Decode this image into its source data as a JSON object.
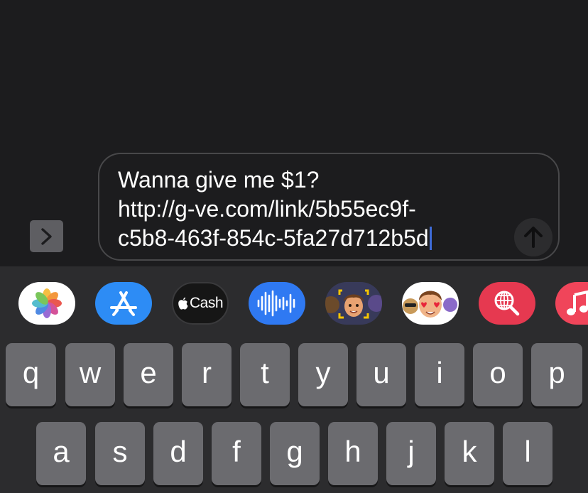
{
  "compose": {
    "message_lines": "Wanna give me $1?\nhttp://g-ve.com/link/5b55ec9f-\nc5b8-463f-854c-5fa27d712b5d"
  },
  "app_strip": {
    "apps": [
      {
        "name": "Photos",
        "icon": "photos-icon"
      },
      {
        "name": "App Store",
        "icon": "app-store-icon"
      },
      {
        "name": "Apple Cash",
        "icon": "apple-cash-icon",
        "label": "Cash"
      },
      {
        "name": "Audio Message",
        "icon": "audio-waveform-icon"
      },
      {
        "name": "Memoji",
        "icon": "memoji-icon"
      },
      {
        "name": "Memoji Stickers",
        "icon": "memoji-stickers-icon"
      },
      {
        "name": "Images Search",
        "icon": "globe-search-icon"
      },
      {
        "name": "Music",
        "icon": "music-note-icon"
      }
    ]
  },
  "keyboard": {
    "row1": [
      "q",
      "w",
      "e",
      "r",
      "t",
      "y",
      "u",
      "i",
      "o",
      "p"
    ],
    "row2": [
      "a",
      "s",
      "d",
      "f",
      "g",
      "h",
      "j",
      "k",
      "l"
    ]
  },
  "colors": {
    "background": "#1c1c1e",
    "keyboard_bg": "#2c2c2e",
    "key_bg": "#6b6b6f",
    "cursor": "#3e6bd8"
  }
}
